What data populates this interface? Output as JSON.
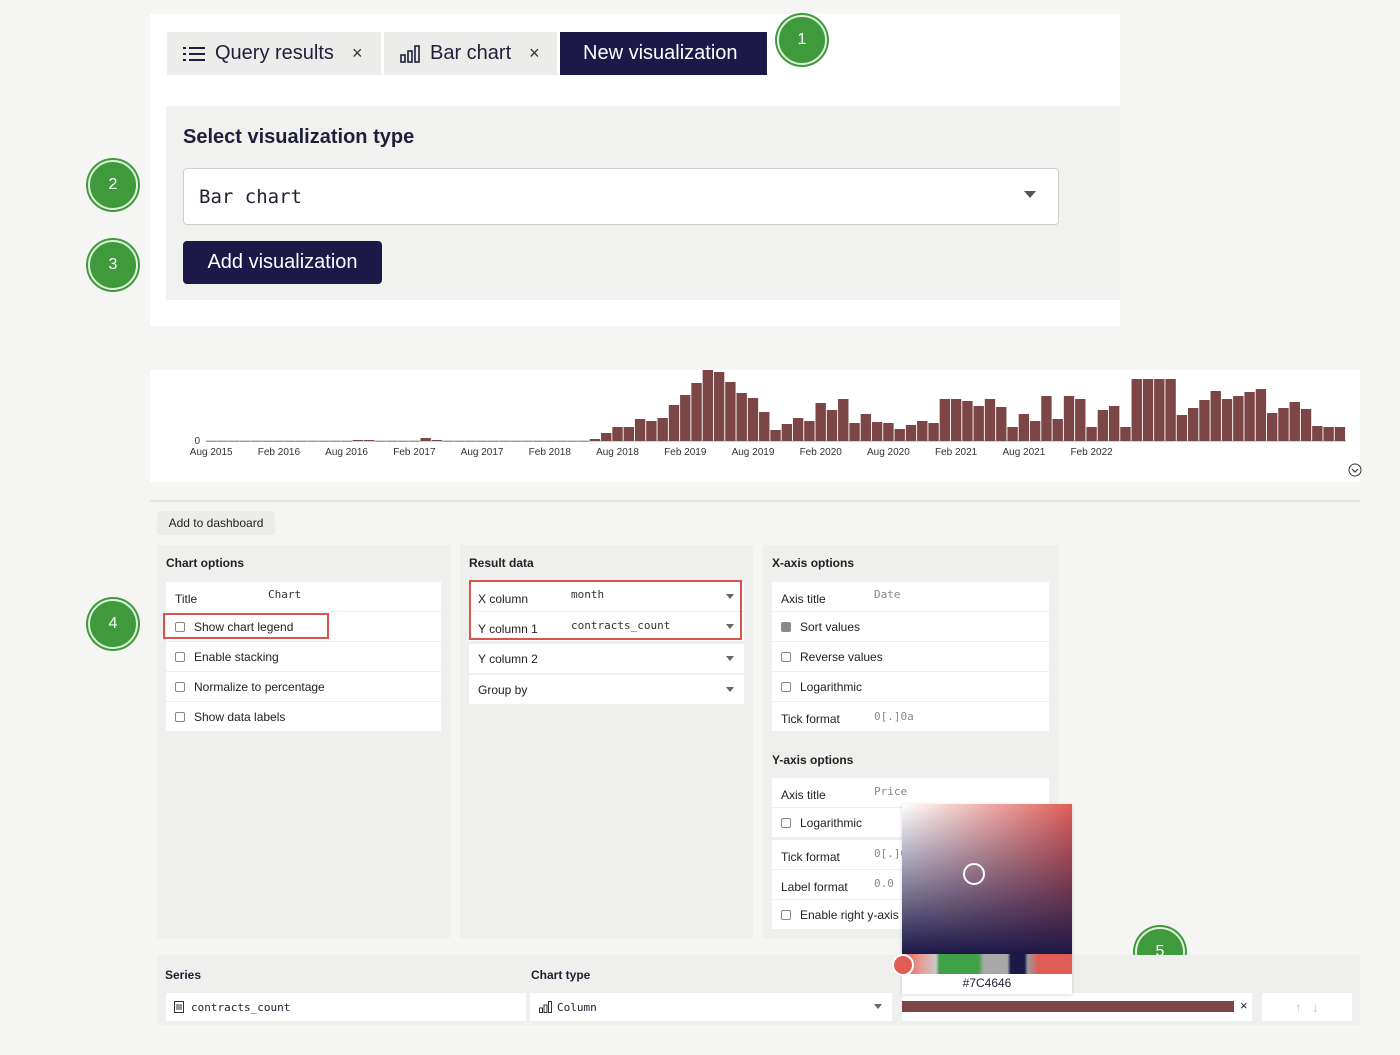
{
  "tabs": [
    {
      "label": "Query results",
      "icon": "list-icon",
      "closable": true
    },
    {
      "label": "Bar chart",
      "icon": "bar-chart-icon",
      "closable": true
    },
    {
      "label": "New visualization",
      "active": true
    }
  ],
  "tab_close_glyph": "×",
  "visualization": {
    "heading": "Select visualization type",
    "selected_type": "Bar chart",
    "add_button": "Add visualization"
  },
  "badges": [
    "1",
    "2",
    "3",
    "4",
    "5"
  ],
  "chart_data": {
    "type": "bar",
    "color": "#7C4646",
    "y_tick_labels": [
      "0"
    ],
    "x_tick_labels": [
      "Aug 2015",
      "Feb 2016",
      "Aug 2016",
      "Feb 2017",
      "Aug 2017",
      "Feb 2018",
      "Aug 2018",
      "Feb 2019",
      "Aug 2019",
      "Feb 2020",
      "Aug 2020",
      "Feb 2021",
      "Aug 2021",
      "Feb 2022"
    ],
    "values": [
      0,
      0,
      0,
      0,
      0,
      0,
      0,
      0,
      0,
      0,
      0,
      0,
      0,
      1,
      1,
      0,
      0,
      0,
      0,
      3,
      1,
      0,
      0,
      0,
      0,
      0,
      0,
      0,
      0,
      0,
      0,
      0,
      0,
      0,
      2,
      8,
      14,
      14,
      22,
      20,
      23,
      36,
      46,
      58,
      71,
      69,
      59,
      48,
      43,
      29,
      11,
      17,
      23,
      20,
      38,
      31,
      42,
      18,
      27,
      19,
      18,
      12,
      16,
      20,
      18,
      42,
      42,
      40,
      35,
      42,
      34,
      14,
      27,
      20,
      45,
      22,
      45,
      42,
      14,
      31,
      35,
      14,
      62,
      62,
      62,
      62,
      26,
      33,
      41,
      50,
      42,
      45,
      49,
      52,
      28,
      33,
      39,
      32,
      15,
      14,
      14
    ],
    "ylim": [
      0,
      71
    ]
  },
  "add_to_dashboard": "Add to dashboard",
  "chart_options": {
    "title": "Chart options",
    "title_label": "Title",
    "title_value": "Chart",
    "show_legend": "Show chart legend",
    "enable_stacking": "Enable stacking",
    "normalize": "Normalize to percentage",
    "show_data_labels": "Show data labels"
  },
  "result_data": {
    "title": "Result data",
    "x_column_label": "X column",
    "x_column_value": "month",
    "y_column1_label": "Y column 1",
    "y_column1_value": "contracts_count",
    "y_column2_label": "Y column 2",
    "group_by_label": "Group by"
  },
  "x_axis": {
    "title": "X-axis options",
    "axis_title_label": "Axis title",
    "axis_title_placeholder": "Date",
    "sort_values": "Sort values",
    "reverse_values": "Reverse values",
    "logarithmic": "Logarithmic",
    "tick_format_label": "Tick format",
    "tick_format_placeholder": "0[.]0a"
  },
  "y_axis": {
    "title": "Y-axis options",
    "axis_title_label": "Axis title",
    "axis_title_placeholder": "Price",
    "logarithmic": "Logarithmic",
    "tick_format_label": "Tick format",
    "tick_format_placeholder": "0[.]0a",
    "label_format_label": "Label format",
    "label_format_placeholder": "0.0",
    "right_axis": "Enable right y-axis"
  },
  "series": {
    "header_series": "Series",
    "header_chart_type": "Chart type",
    "name": "contracts_count",
    "chart_type": "Column",
    "color": "#7C4646",
    "color_hex_label": "#7C4646",
    "remove_glyph": "×",
    "up_glyph": "↑",
    "down_glyph": "↓"
  }
}
